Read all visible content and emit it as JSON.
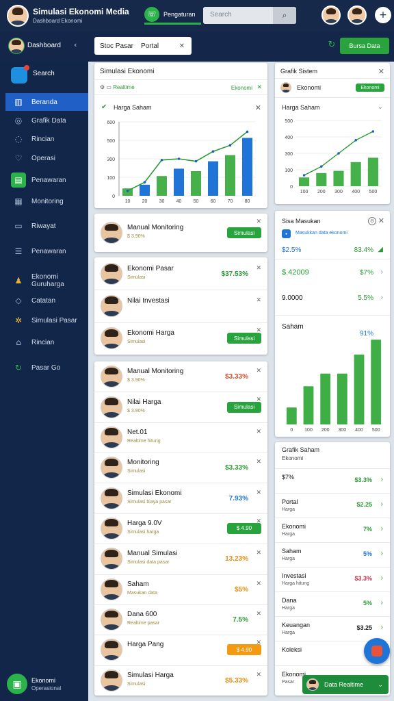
{
  "header": {
    "title": "Simulasi Ekonomi Media",
    "subtitle": "Dashboard Ekonomi",
    "tab_label": "Pengaturan",
    "search_placeholder": "Search"
  },
  "subbar": {
    "user_label": "Dashboard",
    "filter_text": "Stoc Pasar    Portal",
    "action_button": "Bursa Data"
  },
  "sidebar": {
    "items": [
      {
        "label": "Search",
        "icon": "home-icon"
      },
      {
        "label": "Beranda",
        "icon": "chart-icon"
      },
      {
        "label": "Grafik Data",
        "icon": "globe-icon"
      },
      {
        "label": "Rincian",
        "icon": "compass-icon"
      },
      {
        "label": "Operasi",
        "icon": "heart-icon"
      },
      {
        "label": "Penawaran",
        "icon": "cart-icon"
      },
      {
        "label": "Monitoring",
        "icon": "calendar-icon"
      },
      {
        "label": "Riwayat",
        "icon": "document-icon"
      },
      {
        "label": "Penawaran",
        "icon": "list-icon"
      },
      {
        "label": "Ekonomi Guruharga",
        "icon": "person-icon"
      },
      {
        "label": "Catatan",
        "icon": "tag-icon"
      },
      {
        "label": "Simulasi Pasar",
        "icon": "gear-icon"
      },
      {
        "label": "Rincian",
        "icon": "bank-icon"
      },
      {
        "label": "Pasar Go",
        "icon": "refresh-icon"
      }
    ],
    "footer_name": "Ekonomi",
    "footer_sub": "Operasional"
  },
  "chart_card": {
    "title": "Simulasi Ekonomi",
    "tag": "Realtime",
    "filter": "Ekonomi",
    "sub_title": "Harga Saham",
    "chart_data": {
      "type": "bar",
      "categories": [
        "10",
        "20",
        "30",
        "40",
        "50",
        "60",
        "70",
        "80"
      ],
      "series": [
        {
          "values": [
            60,
            90,
            160,
            220,
            200,
            280,
            330,
            470
          ],
          "kind": "bar"
        },
        {
          "values": [
            40,
            110,
            290,
            300,
            280,
            360,
            410,
            520
          ],
          "kind": "line"
        }
      ],
      "ylim": [
        0,
        600
      ],
      "yticks": [
        "0",
        "100",
        "300",
        "500",
        "600"
      ]
    }
  },
  "right_chart_card": {
    "title": "Grafik Sistem",
    "badge": "Ekonomi",
    "sub_title": "Harga Saham",
    "chart_data": {
      "type": "bar",
      "categories": [
        "100",
        "200",
        "300",
        "400",
        "500"
      ],
      "series": [
        {
          "values": [
            80,
            120,
            140,
            220,
            260
          ],
          "kind": "bar"
        },
        {
          "values": [
            100,
            180,
            300,
            420,
            500
          ],
          "kind": "line"
        }
      ],
      "ylim": [
        0,
        600
      ],
      "yticks": [
        "0",
        "100",
        "300",
        "400",
        "500"
      ]
    }
  },
  "summary_card": {
    "title": "Sisa Masukan",
    "note": "Masukkan data ekonomi",
    "values": [
      {
        "label": "$2.5%",
        "value": "83.4%"
      },
      {
        "label": "$.42009",
        "value": "$7%"
      },
      {
        "label": "9.0000",
        "value": "5.5%"
      },
      {
        "label": "Saham",
        "value": "91%"
      }
    ],
    "bar_chart": {
      "type": "bar",
      "categories": [
        "0",
        "100",
        "200",
        "300",
        "400",
        "500"
      ],
      "values": [
        80,
        180,
        240,
        240,
        330,
        400
      ]
    }
  },
  "people": [
    {
      "name": "Manual Monitoring",
      "sub": "$ 3.90%",
      "value": "",
      "action": "Simulasi"
    },
    {
      "name": "Ekonomi Pasar",
      "sub": "Simulasi",
      "value": "$37.53%",
      "action": ""
    },
    {
      "name": "Nilai Investasi",
      "sub": "",
      "value": "",
      "action": ""
    },
    {
      "name": "Ekonomi Harga",
      "sub": "Simulasi",
      "value": "",
      "action": "Simulasi"
    },
    {
      "name": "Manual Monitoring",
      "sub": "$ 3.90%",
      "value": "$3.33%",
      "action": ""
    },
    {
      "name": "Nilai Harga",
      "sub": "$ 3.90%",
      "value": "",
      "action": "Simulasi"
    },
    {
      "name": "Net.01",
      "sub": "Realtime hitung",
      "value": "",
      "action": ""
    },
    {
      "name": "Monitoring",
      "sub": "Simulasi",
      "value": "$3.33%",
      "action": ""
    },
    {
      "name": "Simulasi Ekonomi",
      "sub": "Simulasi biaya pasar",
      "value": "7.93%",
      "action": ""
    },
    {
      "name": "Harga 9.0V",
      "sub": "Simulasi harga",
      "value": "",
      "action": "$ 4.90"
    },
    {
      "name": "Manual Simulasi",
      "sub": "Simulasi data pasar",
      "value": "13.23%",
      "action": ""
    },
    {
      "name": "Saham",
      "sub": "Masukan data",
      "value": "$5%",
      "action": ""
    },
    {
      "name": "Dana 600",
      "sub": "Realtime pasar",
      "value": "7.5%",
      "action": ""
    },
    {
      "name": "Harga Pang",
      "sub": "",
      "value": "",
      "action": "$ 4.90"
    },
    {
      "name": "Simulasi Harga",
      "sub": "Simulasi",
      "value": "$5.33%",
      "action": ""
    }
  ],
  "right_list": {
    "title": "Grafik Saham",
    "subtitle": "Ekonomi",
    "rows": [
      {
        "name": "$7%",
        "sub": "",
        "value": "$3.3%"
      },
      {
        "name": "Portal",
        "sub": "Harga",
        "value": "$2.25"
      },
      {
        "name": "Ekonomi",
        "sub": "Harga",
        "value": "7%"
      },
      {
        "name": "Saham",
        "sub": "Harga",
        "value": "5%"
      },
      {
        "name": "Investasi",
        "sub": "Harga hitung",
        "value": "$3.3%"
      },
      {
        "name": "Dana",
        "sub": "Harga",
        "value": "5%"
      },
      {
        "name": "Keuangan",
        "sub": "Harga",
        "value": "$3.25"
      },
      {
        "name": "Koleksi",
        "sub": "",
        "value": ""
      },
      {
        "name": "Ekonomi",
        "sub": "Pasar",
        "value": ""
      }
    ]
  },
  "toast": {
    "label": "Data Realtime"
  }
}
